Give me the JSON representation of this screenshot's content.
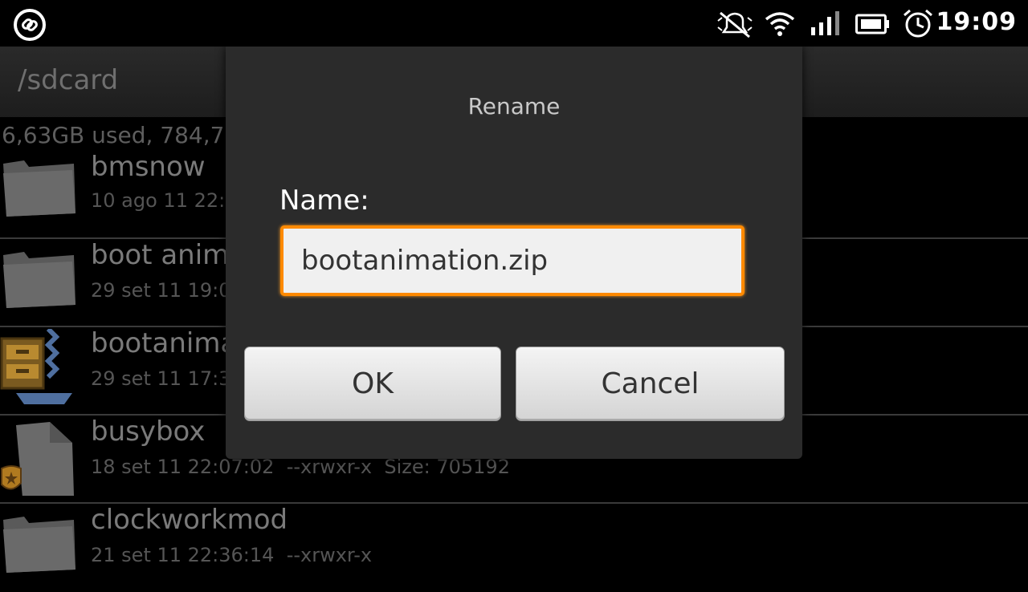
{
  "status_bar": {
    "time": "19:09",
    "icons": [
      "link-icon",
      "silent-icon",
      "wifi-icon",
      "signal-icon",
      "battery-icon",
      "alarm-icon"
    ]
  },
  "file_manager": {
    "path": "/sdcard",
    "usage": "6,63GB used, 784,7",
    "items": [
      {
        "name": "bmsnow",
        "meta": "10 ago 11 22:",
        "icon": "folder-icon"
      },
      {
        "name": "boot anim",
        "meta": "29 set 11 19:0",
        "icon": "folder-icon"
      },
      {
        "name": "bootanima",
        "meta": "29 set 11 17:3",
        "icon": "archive-icon"
      },
      {
        "name": "busybox",
        "meta": "18 set 11 22:07:02  --xrwxr-x  Size: 705192",
        "icon": "executable-file-icon"
      },
      {
        "name": "clockworkmod",
        "meta": "21 set 11 22:36:14  --xrwxr-x",
        "icon": "folder-icon"
      }
    ]
  },
  "dialog": {
    "title": "Rename",
    "field_label": "Name:",
    "field_value": "bootanimation.zip",
    "ok_label": "OK",
    "cancel_label": "Cancel",
    "accent_color": "#ff8a00"
  }
}
